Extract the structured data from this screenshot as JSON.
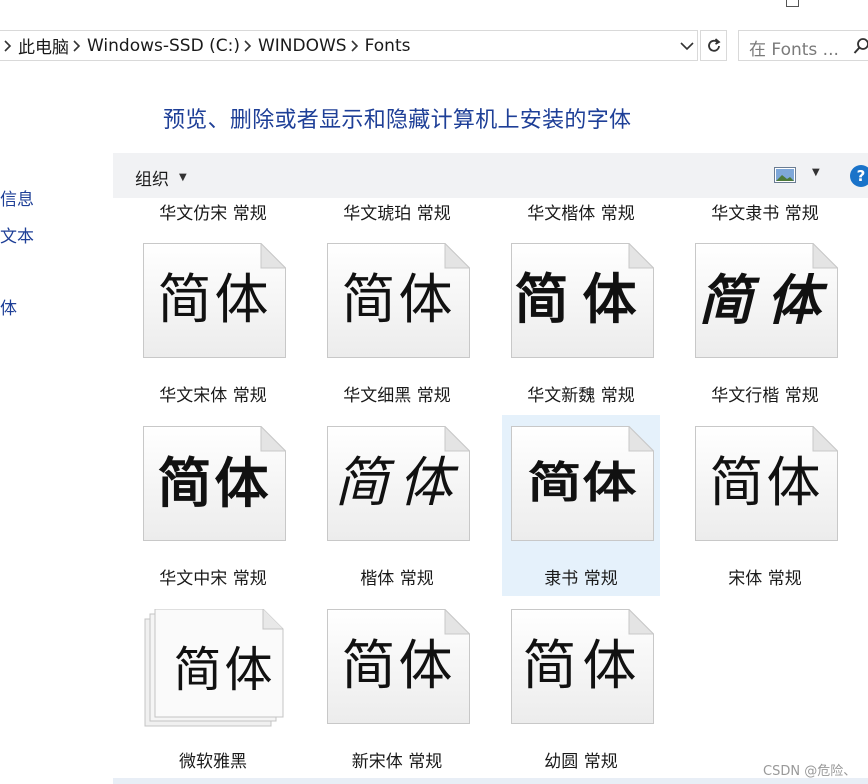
{
  "window": {
    "maximize_label": ""
  },
  "address": {
    "crumbs": [
      "此电脑",
      "Windows-SSD (C:)",
      "WINDOWS",
      "Fonts"
    ]
  },
  "search": {
    "placeholder": "在 Fonts ..."
  },
  "page_title": "预览、删除或者显示和隐藏计算机上安装的字体",
  "left_nav": [
    "信息",
    "文本",
    "体"
  ],
  "toolbar": {
    "organize_label": "组织",
    "help_label": "?"
  },
  "top_row_labels": [
    "华文仿宋 常规",
    "华文琥珀 常规",
    "华文楷体 常规",
    "华文隶书 常规"
  ],
  "fonts": [
    {
      "name": "华文宋体 常规",
      "sample": "简体",
      "style": "g-song",
      "icon": "font-file-icon",
      "selected": false
    },
    {
      "name": "华文细黑 常规",
      "sample": "简体",
      "style": "g-xihei",
      "icon": "font-file-icon",
      "selected": false
    },
    {
      "name": "华文新魏 常规",
      "sample": "简体",
      "style": "g-wei",
      "icon": "font-file-icon",
      "selected": false
    },
    {
      "name": "华文行楷 常规",
      "sample": "简体",
      "style": "g-xing",
      "icon": "font-file-icon",
      "selected": false
    },
    {
      "name": "华文中宋 常规",
      "sample": "简体",
      "style": "g-zhongsong",
      "icon": "font-file-icon",
      "selected": false
    },
    {
      "name": "楷体 常规",
      "sample": "简体",
      "style": "g-kai",
      "icon": "font-file-icon",
      "selected": false
    },
    {
      "name": "隶书 常规",
      "sample": "简体",
      "style": "g-li",
      "icon": "font-file-icon",
      "selected": true
    },
    {
      "name": "宋体 常规",
      "sample": "简体",
      "style": "g-songti",
      "icon": "font-file-icon",
      "selected": false
    },
    {
      "name": "微软雅黑",
      "sample": "简体",
      "style": "g-yahei",
      "icon": "font-family-stack-icon",
      "selected": false
    },
    {
      "name": "新宋体 常规",
      "sample": "简体",
      "style": "g-xinsong",
      "icon": "font-file-icon",
      "selected": false
    },
    {
      "name": "幼圆 常规",
      "sample": "简体",
      "style": "g-youyuan",
      "icon": "font-file-icon",
      "selected": false
    }
  ],
  "colors": {
    "title": "#1e3f97",
    "selection": "#e5f1fb",
    "toolbar": "#f1f2f4",
    "help": "#1a73c9"
  },
  "watermark": "CSDN @危险、"
}
